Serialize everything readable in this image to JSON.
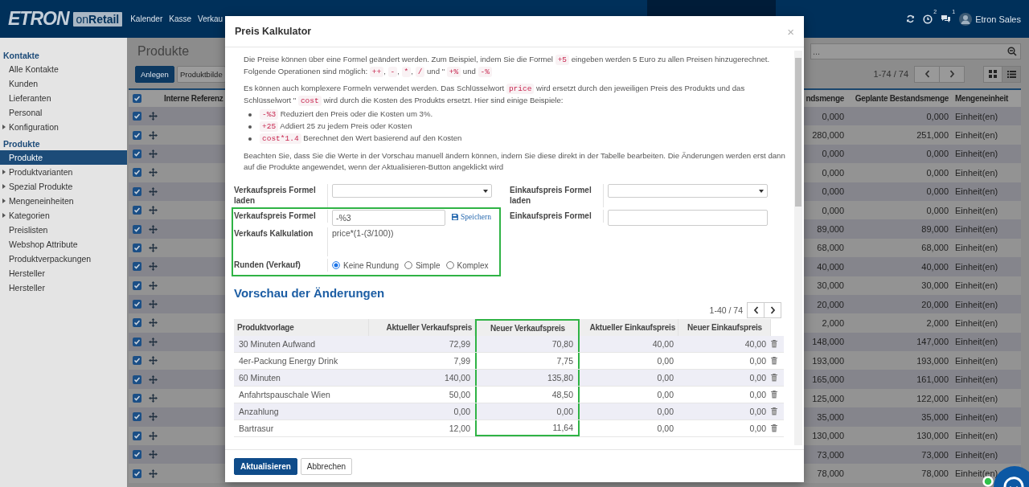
{
  "top_bar": {
    "logo": "ETRON",
    "logo_suffix": "on**Retail**",
    "nav": [
      "Kalender",
      "Kasse",
      "Verkau"
    ],
    "notifications": [
      {
        "kind": "clock",
        "count": "2"
      },
      {
        "kind": "chat",
        "count": "1"
      }
    ],
    "user": "Etron Sales"
  },
  "sidebar": {
    "sections": [
      {
        "title": "Kontakte",
        "items": [
          {
            "label": "Alle Kontakte",
            "has_children": false,
            "selected": false
          },
          {
            "label": "Kunden",
            "has_children": false,
            "selected": false
          },
          {
            "label": "Lieferanten",
            "has_children": false,
            "selected": false
          },
          {
            "label": "Personal",
            "has_children": false,
            "selected": false
          },
          {
            "label": "Konfiguration",
            "has_children": true,
            "selected": false
          }
        ]
      },
      {
        "title": "Produkte",
        "items": [
          {
            "label": "Produkte",
            "has_children": false,
            "selected": true
          },
          {
            "label": "Produktvarianten",
            "has_children": true,
            "selected": false
          },
          {
            "label": "Spezial Produkte",
            "has_children": true,
            "selected": false
          },
          {
            "label": "Mengeneinheiten",
            "has_children": true,
            "selected": false
          },
          {
            "label": "Kategorien",
            "has_children": true,
            "selected": false
          },
          {
            "label": "Preislisten",
            "has_children": false,
            "selected": false
          },
          {
            "label": "Webshop Attribute",
            "has_children": false,
            "selected": false
          },
          {
            "label": "Produktverpackungen",
            "has_children": false,
            "selected": false
          },
          {
            "label": "Hersteller",
            "has_children": false,
            "selected": false
          },
          {
            "label": "Hersteller",
            "has_children": false,
            "selected": false
          }
        ]
      }
    ]
  },
  "page": {
    "title": "Produkte",
    "buttons": [
      "Anlegen",
      "Produktbilde"
    ],
    "search": {
      "placeholder": "..."
    },
    "pager": "1-74 / 74",
    "views": [
      {
        "kind": "kanban",
        "selected": false
      },
      {
        "kind": "list",
        "selected": true
      }
    ],
    "table": {
      "header_checked": true,
      "columns": [
        "Interne Referenz",
        "ndsmenge",
        "Geplante Bestandsmenge",
        "Mengeneinheit"
      ],
      "rows": [
        {
          "checked": true,
          "quantity": "0,000",
          "planned": "0,000",
          "unit": "Einheit(en)"
        },
        {
          "checked": true,
          "quantity": "280,000",
          "planned": "251,000",
          "unit": "Einheit(en)"
        },
        {
          "checked": true,
          "quantity": "0,000",
          "planned": "0,000",
          "unit": "Einheit(en)"
        },
        {
          "checked": true,
          "quantity": "0,000",
          "planned": "0,000",
          "unit": "Einheit(en)"
        },
        {
          "checked": true,
          "quantity": "0,000",
          "planned": "0,000",
          "unit": "Einheit(en)"
        },
        {
          "checked": true,
          "quantity": "0,000",
          "planned": "0,000",
          "unit": "Einheit(en)"
        },
        {
          "checked": true,
          "quantity": "89,000",
          "planned": "89,000",
          "unit": "Einheit(en)"
        },
        {
          "checked": true,
          "quantity": "68,000",
          "planned": "68,000",
          "unit": "Einheit(en)"
        },
        {
          "checked": true,
          "quantity": "40,000",
          "planned": "40,000",
          "unit": "Einheit(en)"
        },
        {
          "checked": true,
          "quantity": "30,000",
          "planned": "30,000",
          "unit": "Einheit(en)"
        },
        {
          "checked": true,
          "quantity": "20,000",
          "planned": "20,000",
          "unit": "Einheit(en)"
        },
        {
          "checked": true,
          "quantity": "2,000",
          "planned": "2,000",
          "unit": "Einheit(en)"
        },
        {
          "checked": true,
          "quantity": "148,000",
          "planned": "147,000",
          "unit": "Einheit(en)"
        },
        {
          "checked": true,
          "quantity": "193,000",
          "planned": "193,000",
          "unit": "Einheit(en)"
        },
        {
          "checked": true,
          "quantity": "165,000",
          "planned": "161,000",
          "unit": "Einheit(en)"
        },
        {
          "checked": true,
          "quantity": "125,000",
          "planned": "122,000",
          "unit": "Einheit(en)"
        },
        {
          "checked": true,
          "quantity": "35,000",
          "planned": "35,000",
          "unit": "Einheit(en)"
        },
        {
          "checked": true,
          "quantity": "130,000",
          "planned": "130,000",
          "unit": "Einheit(en)"
        },
        {
          "checked": true,
          "quantity": "73,000",
          "planned": "73,000",
          "unit": "Einheit(en)"
        },
        {
          "checked": true,
          "quantity": "78,000",
          "planned": "78,000",
          "unit": "Einheit(en)"
        }
      ]
    }
  },
  "dialog": {
    "title": "Preis Kalkulator",
    "close": "×",
    "paragraphs": [
      [
        {
          "kind": "text",
          "text": "Die Preise können über eine Formel geändert werden. Zum Beispiel, indem Sie die Formel "
        },
        {
          "kind": "code",
          "text": "+5"
        },
        {
          "kind": "text",
          "text": " eingeben werden 5 Euro zu allen Preisen hinzugerechnet. Folgende Operationen sind möglich: "
        },
        {
          "kind": "code",
          "text": "++"
        },
        {
          "kind": "text",
          "text": ", "
        },
        {
          "kind": "code",
          "text": "-"
        },
        {
          "kind": "text",
          "text": ", "
        },
        {
          "kind": "code",
          "text": "*"
        },
        {
          "kind": "text",
          "text": ", "
        },
        {
          "kind": "code",
          "text": "/"
        },
        {
          "kind": "text",
          "text": " und \" "
        },
        {
          "kind": "code",
          "text": "+%"
        },
        {
          "kind": "text",
          "text": " und "
        },
        {
          "kind": "code",
          "text": "-%"
        }
      ],
      [
        {
          "kind": "text",
          "text": "Es können auch komplexere Formeln verwendet werden. Das Schlüsselwort "
        },
        {
          "kind": "code",
          "text": "price"
        },
        {
          "kind": "text",
          "text": " wird ersetzt durch den jeweiligen Preis des Produkts und das Schlüsselwort \" "
        },
        {
          "kind": "code",
          "text": "cost"
        },
        {
          "kind": "text",
          "text": " wird durch die Kosten des Produkts ersetzt. Hier sind einige Beispiele:"
        }
      ]
    ],
    "examples": [
      [
        {
          "kind": "code",
          "text": "-%3"
        },
        {
          "kind": "text",
          "text": " Reduziert den Preis oder die Kosten um 3%."
        }
      ],
      [
        {
          "kind": "code",
          "text": "+25"
        },
        {
          "kind": "text",
          "text": " Addiert 25 zu jedem Preis oder Kosten"
        }
      ],
      [
        {
          "kind": "code",
          "text": "cost*1.4"
        },
        {
          "kind": "text",
          "text": " Berechnet den Wert basierend auf den Kosten"
        }
      ]
    ],
    "note": "Beachten Sie, dass Sie die Werte in der Vorschau manuell ändern können, indem Sie diese direkt in der Tabelle bearbeiten. Die Änderungen werden erst dann auf die Produkte angewendet, wenn der Aktualisieren-Button angeklickt wird",
    "form": {
      "sales": {
        "highlighted": true,
        "load_label": "Verkaufspreis Formel laden",
        "formula_label": "Verkaufspreis Formel",
        "formula_value": "-%3",
        "save": "Speichern",
        "calc_label": "Verkaufs Kalkulation",
        "calc_value": "price*(1-(3/100))",
        "rounding_label": "Runden (Verkauf)",
        "rounding_options": [
          {
            "label": "Keine Rundung",
            "selected": true
          },
          {
            "label": "Simple",
            "selected": false
          },
          {
            "label": "Komplex",
            "selected": false
          }
        ]
      },
      "purchase": {
        "load_label": "Einkaufspreis Formel laden",
        "formula_label": "Einkaufspreis Formel"
      }
    },
    "preview": {
      "title": "Vorschau der Änderungen",
      "pager": "1-40 / 74",
      "columns": [
        {
          "label": "Produktvorlage",
          "highlighted": false
        },
        {
          "label": "Aktueller Verkaufspreis",
          "highlighted": false
        },
        {
          "label": "Neuer Verkaufspreis",
          "highlighted": true
        },
        {
          "label": "Aktueller Einkaufspreis",
          "highlighted": false
        },
        {
          "label": "Neuer Einkaufspreis",
          "highlighted": false
        }
      ],
      "rows": [
        [
          "30 Minuten Aufwand",
          "72,99",
          "70,80",
          "40,00",
          "40,00"
        ],
        [
          "4er-Packung Energy Drink",
          "7,99",
          "7,75",
          "0,00",
          "0,00"
        ],
        [
          "60 Minuten",
          "140,00",
          "135,80",
          "0,00",
          "0,00"
        ],
        [
          "Anfahrtspauschale Wien",
          "50,00",
          "48,50",
          "0,00",
          "0,00"
        ],
        [
          "Anzahlung",
          "0,00",
          "0,00",
          "0,00",
          "0,00"
        ],
        [
          "Bartrasur",
          "12,00",
          "11,64",
          "0,00",
          "0,00"
        ]
      ]
    },
    "buttons": [
      {
        "kind": "primary",
        "label": "Aktualisieren"
      },
      {
        "kind": "secondary",
        "label": "Abbrechen"
      }
    ]
  }
}
